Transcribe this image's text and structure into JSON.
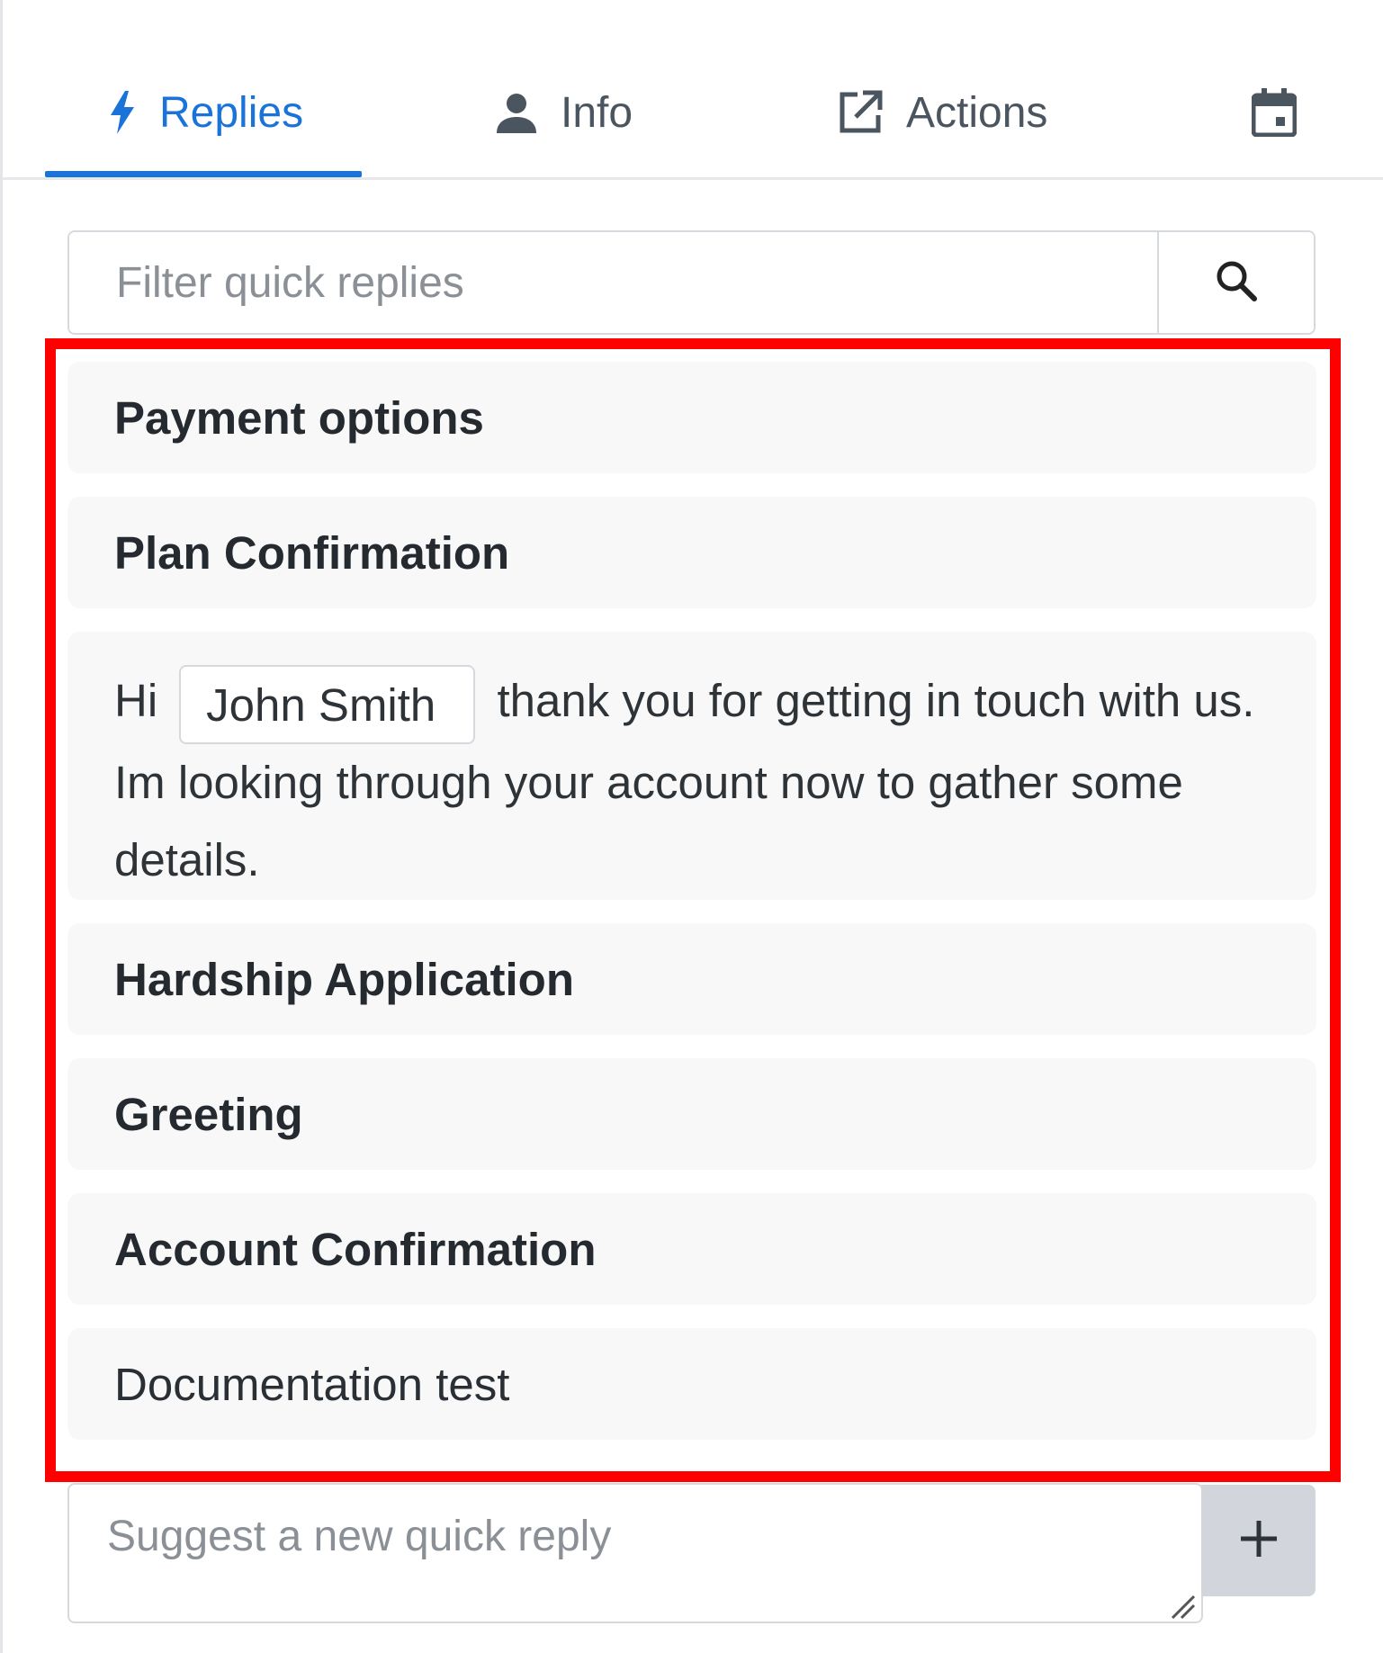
{
  "tabs": [
    {
      "label": "Replies",
      "icon": "lightning-icon",
      "active": true
    },
    {
      "label": "Info",
      "icon": "person-icon",
      "active": false
    },
    {
      "label": "Actions",
      "icon": "external-link-icon",
      "active": false
    },
    {
      "label": "",
      "icon": "calendar-icon",
      "active": false
    }
  ],
  "colors": {
    "accent": "#1a73d9",
    "highlight": "#ff0000"
  },
  "filter": {
    "placeholder": "Filter quick replies"
  },
  "replies": {
    "item1": "Payment options",
    "item2": "Plan Confirmation",
    "expanded": {
      "prefix": "Hi",
      "token": "John Smith",
      "suffix": "thank you for getting in touch with us. Im looking through your account now to gather some details."
    },
    "item3": "Hardship Application",
    "item4": "Greeting",
    "item5": "Account Confirmation",
    "item6": "Documentation test"
  },
  "suggest": {
    "placeholder": "Suggest a new quick reply",
    "add_icon": "plus-icon"
  }
}
